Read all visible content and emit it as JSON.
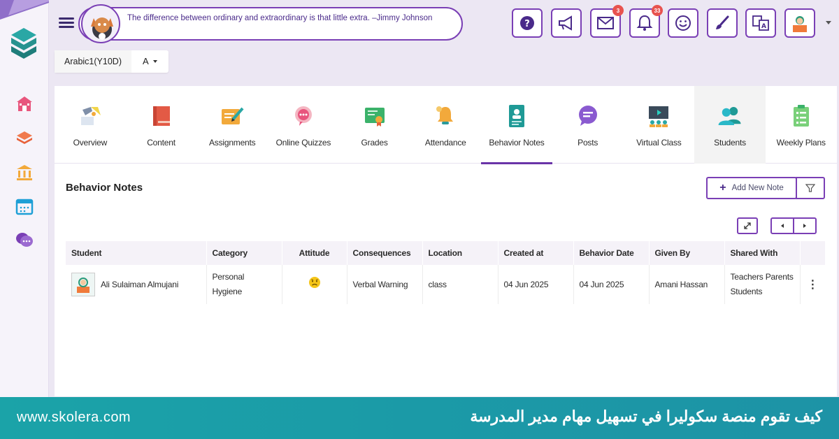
{
  "header": {
    "quote": "The difference between ordinary and extraordinary is that little extra. –Jimmy Johnson",
    "notifications": {
      "messages_badge": "3",
      "alerts_badge": "33"
    }
  },
  "subject_bar": {
    "subject": "Arabic1(Y10D)",
    "section": "A"
  },
  "tabs": [
    {
      "label": "Overview",
      "icon": "overview-icon"
    },
    {
      "label": "Content",
      "icon": "content-icon"
    },
    {
      "label": "Assignments",
      "icon": "assignments-icon"
    },
    {
      "label": "Online Quizzes",
      "icon": "quizzes-icon"
    },
    {
      "label": "Grades",
      "icon": "grades-icon"
    },
    {
      "label": "Attendance",
      "icon": "attendance-icon"
    },
    {
      "label": "Behavior Notes",
      "icon": "behavior-notes-icon"
    },
    {
      "label": "Posts",
      "icon": "posts-icon"
    },
    {
      "label": "Virtual Class",
      "icon": "virtual-class-icon"
    },
    {
      "label": "Students",
      "icon": "students-icon"
    },
    {
      "label": "Weekly Plans",
      "icon": "weekly-plans-icon"
    }
  ],
  "behavior": {
    "title": "Behavior Notes",
    "add_label": "Add New Note",
    "columns": [
      "Student",
      "Category",
      "Attitude",
      "Consequences",
      "Location",
      "Created at",
      "Behavior Date",
      "Given By",
      "Shared With"
    ],
    "rows": [
      {
        "student": "Ali Sulaiman Almujani",
        "category": "Personal Hygiene",
        "attitude": "negative-face-icon",
        "consequences": "Verbal Warning",
        "location": "class",
        "created_at": "04 Jun 2025",
        "behavior_date": "04 Jun 2025",
        "given_by": "Amani Hassan",
        "shared_with": "Teachers Parents Students"
      }
    ]
  },
  "footer": {
    "url": "www.skolera.com",
    "headline": "كيف تقوم منصة سكوليرا في تسهيل مهام مدير المدرسة"
  },
  "colors": {
    "accent": "#7a3fb5",
    "footer": "#1ba3a8",
    "badge": "#e8534f"
  }
}
